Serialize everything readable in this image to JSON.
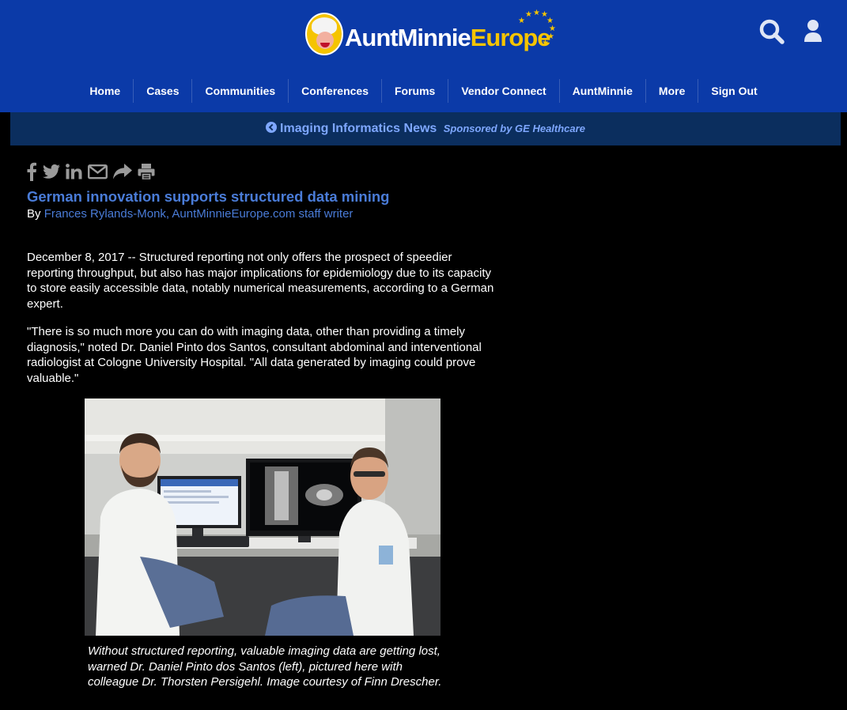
{
  "logo": {
    "brand_main": "AuntMinnie",
    "brand_accent": "Europe"
  },
  "header": {
    "search_icon": "search-icon",
    "user_icon": "user-icon"
  },
  "nav": {
    "items": [
      "Home",
      "Cases",
      "Communities",
      "Conferences",
      "Forums",
      "Vendor Connect",
      "AuntMinnie",
      "More",
      "Sign Out"
    ]
  },
  "news_bar": {
    "title": "Imaging Informatics News",
    "sponsor": "Sponsored by GE Healthcare"
  },
  "share": {
    "icons": [
      "facebook-icon",
      "twitter-icon",
      "linkedin-icon",
      "email-icon",
      "forward-icon",
      "print-icon"
    ]
  },
  "article": {
    "headline": "German innovation supports structured data mining",
    "by_prefix": "By",
    "author": "Frances Rylands-Monk, AuntMinnieEurope.com staff writer",
    "paragraph1": "December 8, 2017 -- Structured reporting not only offers the prospect of speedier reporting throughput, but also has major implications for epidemiology due to its capacity to store easily accessible data, notably numerical measurements, according to a German expert.",
    "paragraph2": "\"There is so much more you can do with imaging data, other than providing a timely diagnosis,\" noted Dr. Daniel Pinto dos Santos, consultant abdominal and interventional radiologist at Cologne University Hospital. \"All data generated by imaging could prove valuable.\"",
    "caption": "Without structured reporting, valuable imaging data are getting lost, warned Dr. Daniel Pinto dos Santos (left), pictured here with colleague Dr. Thorsten Persigehl. Image courtesy of Finn Drescher."
  },
  "colors": {
    "header_bg": "#0b3aa8",
    "news_bar_bg": "#0b2e5e",
    "link_blue": "#4a7cd8",
    "logo_yellow": "#f5c400"
  }
}
